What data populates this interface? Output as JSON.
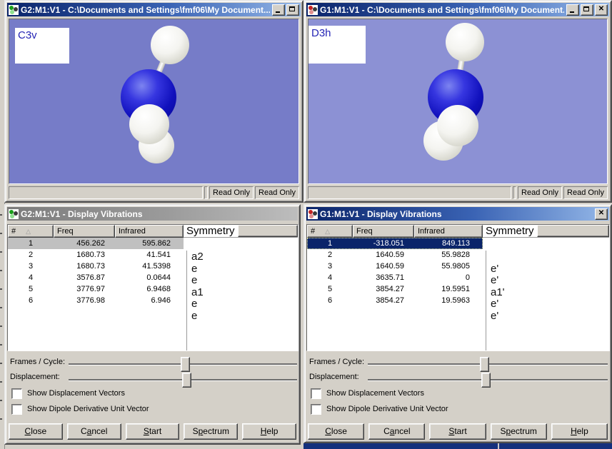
{
  "icons": {
    "minimize": "_",
    "maximize": "□",
    "close": "✕",
    "sort": "△",
    "app_left": "molecule-icon-green",
    "app_right": "molecule-icon-red"
  },
  "colors": {
    "titlebar_active_start": "#0a246a",
    "titlebar_active_end": "#95b8e8",
    "titlebar_inactive_start": "#7b7b7b",
    "titlebar_inactive_end": "#bdbdbd",
    "dialog_face": "#d4d0c8",
    "viewer_left_bg": "#767cc8",
    "viewer_right_bg": "#8c91d4",
    "selection_active": "#0a246a",
    "selection_inactive": "#c0c0c0",
    "nitrogen_atom": "#1111bd",
    "hydrogen_atom": "#f0f0ec"
  },
  "viewer_left": {
    "title": "G2:M1:V1 - C:\\Documents and Settings\\fmf06\\My Document...",
    "point_group_label": "C3v",
    "status": [
      "Read Only",
      "Read Only"
    ]
  },
  "viewer_right": {
    "title": "G1:M1:V1 - C:\\Documents and Settings\\fmf06\\My Document...",
    "point_group_label": "D3h",
    "status": [
      "Read Only",
      "Read Only"
    ]
  },
  "dialog_left": {
    "title": "G2:M1:V1 - Display Vibrations",
    "table": {
      "headers": {
        "num": "#",
        "freq": "Freq",
        "infrared": "Infrared",
        "symmetry": "Symmetry"
      },
      "rows": [
        {
          "num": "1",
          "freq": "456.262",
          "ir": "595.862",
          "sym": "a2"
        },
        {
          "num": "2",
          "freq": "1680.73",
          "ir": "41.541",
          "sym": "e"
        },
        {
          "num": "3",
          "freq": "1680.73",
          "ir": "41.5398",
          "sym": "e"
        },
        {
          "num": "4",
          "freq": "3576.87",
          "ir": "0.0644",
          "sym": "a1"
        },
        {
          "num": "5",
          "freq": "3776.97",
          "ir": "6.9468",
          "sym": "e"
        },
        {
          "num": "6",
          "freq": "3776.98",
          "ir": "6.946",
          "sym": "e"
        }
      ]
    },
    "controls": {
      "frames_label": "Frames / Cycle:",
      "displacement_label": "Displacement:",
      "check1": "Show Displacement Vectors",
      "check2": "Show Dipole Derivative Unit Vector"
    },
    "buttons": [
      {
        "pre": "",
        "key": "C",
        "post": "lose"
      },
      {
        "pre": "C",
        "key": "a",
        "post": "ncel"
      },
      {
        "pre": "",
        "key": "S",
        "post": "tart"
      },
      {
        "pre": "S",
        "key": "p",
        "post": "ectrum"
      },
      {
        "pre": "",
        "key": "H",
        "post": "elp"
      }
    ]
  },
  "dialog_right": {
    "title": "G1:M1:V1 - Display Vibrations",
    "table": {
      "headers": {
        "num": "#",
        "freq": "Freq",
        "infrared": "Infrared",
        "symmetry": "Symmetry"
      },
      "rows": [
        {
          "num": "1",
          "freq": "-318.051",
          "ir": "849.113",
          "sym": ""
        },
        {
          "num": "2",
          "freq": "1640.59",
          "ir": "55.9828",
          "sym": "e'"
        },
        {
          "num": "3",
          "freq": "1640.59",
          "ir": "55.9805",
          "sym": "e'"
        },
        {
          "num": "4",
          "freq": "3635.71",
          "ir": "0",
          "sym": "a1'"
        },
        {
          "num": "5",
          "freq": "3854.27",
          "ir": "19.5951",
          "sym": "e'"
        },
        {
          "num": "6",
          "freq": "3854.27",
          "ir": "19.5963",
          "sym": "e'"
        }
      ]
    },
    "controls": {
      "frames_label": "Frames / Cycle:",
      "displacement_label": "Displacement:",
      "check1": "Show Displacement Vectors",
      "check2": "Show Dipole Derivative Unit Vector"
    },
    "buttons": [
      {
        "pre": "",
        "key": "C",
        "post": "lose"
      },
      {
        "pre": "C",
        "key": "a",
        "post": "ncel"
      },
      {
        "pre": "",
        "key": "S",
        "post": "tart"
      },
      {
        "pre": "S",
        "key": "p",
        "post": "ectrum"
      },
      {
        "pre": "",
        "key": "H",
        "post": "elp"
      }
    ]
  }
}
